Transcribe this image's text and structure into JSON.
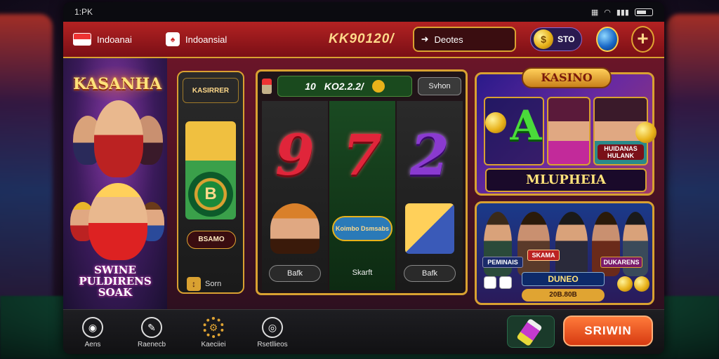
{
  "status_bar": {
    "time": "1:PK"
  },
  "header": {
    "language_label": "Indoanai",
    "region_label": "Indoansial",
    "balance": "KK90120/",
    "deposit_label": "Deotes",
    "coin_label": "STO",
    "add_label": "+"
  },
  "promo": {
    "logo": "KASANHA",
    "title": "SWINE PULDIRENS SOAK"
  },
  "feature_card": {
    "logo": "KASIRRER",
    "disc_label": "B",
    "code": "BSAMO",
    "sort_label": "Sorn"
  },
  "slot": {
    "ticker_number": "10",
    "ticker_amount": "KO2.2.2/",
    "spin_label": "Svhon",
    "reels": [
      {
        "digit": "9",
        "label": "Bafk"
      },
      {
        "digit": "7",
        "art_label": "Koimbo Dsmsabs",
        "label": "Skarft"
      },
      {
        "digit": "2",
        "label": "Bafk"
      }
    ]
  },
  "kasino_card": {
    "title": "KASINO",
    "letter": "A",
    "tile_label": "HUIDANAS HULANK",
    "subtitle": "MLUPHEIA"
  },
  "players_card": {
    "label_left": "PEMINAIS",
    "label_mid": "SKAMA",
    "label_right": "DUKARENS",
    "title": "DUNEO",
    "amount": "20B.80B"
  },
  "bottom_nav": {
    "items": [
      {
        "label": "Aens",
        "icon": "record-icon"
      },
      {
        "label": "Raenecb",
        "icon": "chat-icon"
      },
      {
        "label": "Kaeciiei",
        "icon": "gear-icon"
      },
      {
        "label": "Rsetllieos",
        "icon": "dial-icon"
      }
    ],
    "spin_button": "SRIWIN"
  },
  "colors": {
    "accent_gold": "#d9a131",
    "header_red": "#b32222",
    "spin_orange": "#ff7a3a"
  }
}
